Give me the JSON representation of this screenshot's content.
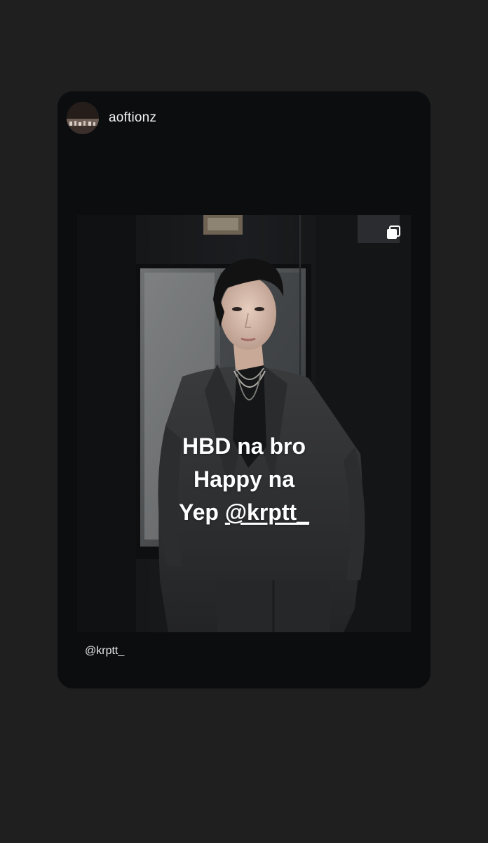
{
  "post": {
    "username": "aoftionz",
    "avatar_icon": "avatar-photo",
    "multi_photo_icon": "carousel-icon",
    "caption": "@krptt_"
  },
  "story_text": {
    "line1": "HBD na bro",
    "line2": "Happy na",
    "line3_prefix": "Yep ",
    "mention": "@krptt_"
  },
  "colors": {
    "background": "#1f1f1f",
    "card": "#0c0d0f",
    "text": "#ffffff"
  }
}
